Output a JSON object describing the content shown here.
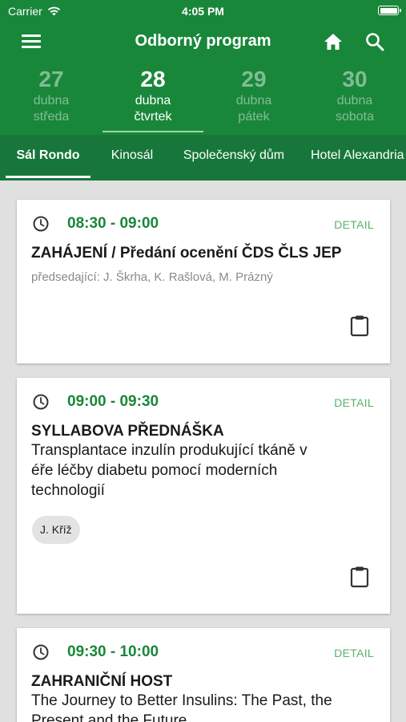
{
  "status_bar": {
    "carrier": "Carrier",
    "time": "4:05 PM"
  },
  "app_bar": {
    "title": "Odborný program"
  },
  "days": [
    {
      "number": "27",
      "month": "dubna",
      "weekday": "středa"
    },
    {
      "number": "28",
      "month": "dubna",
      "weekday": "čtvrtek"
    },
    {
      "number": "29",
      "month": "dubna",
      "weekday": "pátek"
    },
    {
      "number": "30",
      "month": "dubna",
      "weekday": "sobota"
    }
  ],
  "active_day_index": 1,
  "venues": [
    "Sál Rondo",
    "Kinosál",
    "Společenský dům",
    "Hotel Alexandria"
  ],
  "active_venue_index": 0,
  "sessions": [
    {
      "time": "08:30 - 09:00",
      "detail_label": "DETAIL",
      "title": "ZAHÁJENÍ / Předání ocenění ČDS ČLS JEP",
      "chairs": "předsedající: J. Škrha, K. Rašlová, M. Prázný"
    },
    {
      "time": "09:00 - 09:30",
      "detail_label": "DETAIL",
      "title": "SYLLABOVA PŘEDNÁŠKA",
      "subtitle_lines": [
        "Transplantace inzulín produkující tkáně v",
        "éře léčby diabetu pomocí moderních",
        "technologií"
      ],
      "speaker": "J. Kříž"
    },
    {
      "time": "09:30 - 10:00",
      "detail_label": "DETAIL",
      "title": "ZAHRANIČNÍ HOST",
      "subtitle_lines": [
        "The Journey to Better Insulins: The Past, the",
        "Present and the Future"
      ]
    }
  ],
  "colors": {
    "primary": "#19873a",
    "tab_bar": "#17773a",
    "detail": "#5ab36a",
    "background": "#e0e0e0"
  },
  "icons": [
    "menu-icon",
    "home-icon",
    "search-icon",
    "clock-icon",
    "clipboard-icon",
    "wifi-icon",
    "battery-icon"
  ]
}
